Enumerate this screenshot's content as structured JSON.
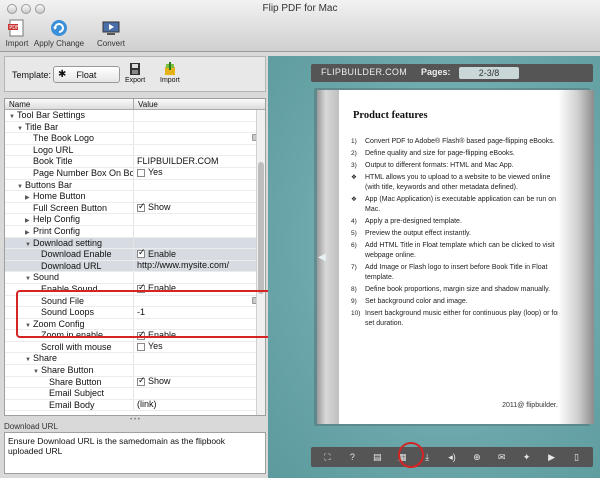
{
  "window": {
    "title": "Flip PDF for Mac"
  },
  "toolbar": {
    "import": "Import",
    "apply_change": "Apply Change",
    "convert": "Convert"
  },
  "template": {
    "label": "Template:",
    "value": "Float",
    "export": "Export",
    "import": "Import"
  },
  "grid": {
    "col_name": "Name",
    "col_value": "Value",
    "rows": [
      {
        "name": "Tool Bar Settings",
        "indent": 0,
        "tri": "down",
        "value": ""
      },
      {
        "name": "Title Bar",
        "indent": 1,
        "tri": "down",
        "value": ""
      },
      {
        "name": "The Book Logo",
        "indent": 2,
        "tri": "",
        "value": "",
        "folder": true
      },
      {
        "name": "Logo URL",
        "indent": 2,
        "tri": "",
        "value": ""
      },
      {
        "name": "Book Title",
        "indent": 2,
        "tri": "",
        "value": "FLIPBUILDER.COM"
      },
      {
        "name": "Page Number Box On Bot...",
        "indent": 2,
        "tri": "",
        "value": "Yes",
        "check": false
      },
      {
        "name": "Buttons Bar",
        "indent": 1,
        "tri": "down",
        "value": ""
      },
      {
        "name": "Home Button",
        "indent": 2,
        "tri": "right",
        "value": ""
      },
      {
        "name": "Full Screen Button",
        "indent": 2,
        "tri": "",
        "value": "Show",
        "check": true
      },
      {
        "name": "Help Config",
        "indent": 2,
        "tri": "right",
        "value": ""
      },
      {
        "name": "Print Config",
        "indent": 2,
        "tri": "right",
        "value": ""
      },
      {
        "name": "Download setting",
        "indent": 2,
        "tri": "down",
        "value": "",
        "sel": true
      },
      {
        "name": "Download Enable",
        "indent": 3,
        "tri": "",
        "value": "Enable",
        "check": true,
        "sel": true
      },
      {
        "name": "Download URL",
        "indent": 3,
        "tri": "",
        "value": "http://www.mysite.com/",
        "sel": true
      },
      {
        "name": "Sound",
        "indent": 2,
        "tri": "down",
        "value": ""
      },
      {
        "name": "Enable Sound",
        "indent": 3,
        "tri": "",
        "value": "Enable",
        "check": true
      },
      {
        "name": "Sound File",
        "indent": 3,
        "tri": "",
        "value": "",
        "folder": true
      },
      {
        "name": "Sound Loops",
        "indent": 3,
        "tri": "",
        "value": "-1"
      },
      {
        "name": "Zoom Config",
        "indent": 2,
        "tri": "down",
        "value": ""
      },
      {
        "name": "Zoom in enable",
        "indent": 3,
        "tri": "",
        "value": "Enable",
        "check": true
      },
      {
        "name": "Scroll with mouse",
        "indent": 3,
        "tri": "",
        "value": "Yes",
        "check": false
      },
      {
        "name": "Share",
        "indent": 2,
        "tri": "down",
        "value": ""
      },
      {
        "name": "Share Button",
        "indent": 3,
        "tri": "down",
        "value": ""
      },
      {
        "name": "Share Button",
        "indent": 4,
        "tri": "",
        "value": "Show",
        "check": true
      },
      {
        "name": "Email Subject",
        "indent": 4,
        "tri": "",
        "value": ""
      },
      {
        "name": "Email Body",
        "indent": 4,
        "tri": "",
        "value": "(link)"
      }
    ]
  },
  "description": {
    "title": "Download URL",
    "text": "Ensure Download URL is the samedomain as the flipbook uploaded URL"
  },
  "preview": {
    "logo": "FLIPBUILDER.COM",
    "pages_label": "Pages:",
    "pages_value": "2-3/8",
    "page_title": "Product features",
    "items": [
      {
        "bullet": "1)",
        "text": "Convert PDF to Adobe® Flash® based page-flipping eBooks."
      },
      {
        "bullet": "2)",
        "text": "Define quality and size for page-flipping eBooks."
      },
      {
        "bullet": "3)",
        "text": "Output to different formats: HTML and Mac App."
      },
      {
        "bullet": "❖",
        "text": "HTML allows you to upload to a website to be viewed online (with title, keywords and other metadata defined)."
      },
      {
        "bullet": "❖",
        "text": "App (Mac Application) is executable application can be run on Mac."
      },
      {
        "bullet": "4)",
        "text": "Apply a pre-designed template."
      },
      {
        "bullet": "5)",
        "text": "Preview the output effect instantly."
      },
      {
        "bullet": "6)",
        "text": "Add HTML Title in Float template which can be clicked to visit webpage online."
      },
      {
        "bullet": "7)",
        "text": "Add Image or Flash logo to insert before Book Title in Float template."
      },
      {
        "bullet": "8)",
        "text": "Define book proportions, margin size and shadow manually."
      },
      {
        "bullet": "9)",
        "text": "Set background color and image."
      },
      {
        "bullet": "10)",
        "text": "Insert background music either for continuous play (loop) or for a set duration."
      }
    ],
    "footer": "2011@ flipbuilder.com"
  },
  "icons": [
    "fit-icon",
    "help-icon",
    "print-icon",
    "thumbnails-icon",
    "download-icon",
    "sound-icon",
    "zoom-icon",
    "email-icon",
    "share-icon",
    "autoplay-icon",
    "pages-icon"
  ]
}
